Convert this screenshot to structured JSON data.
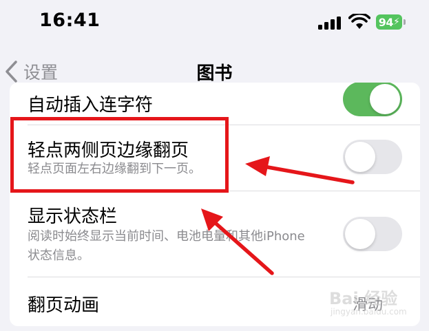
{
  "status_bar": {
    "time": "16:41",
    "battery_level": "94",
    "icons": [
      "cellular-signal-icon",
      "wifi-icon",
      "battery-charging-icon"
    ]
  },
  "nav_bar": {
    "back_label": "设置",
    "title": "图书"
  },
  "settings": {
    "auto_hyphenation": {
      "title": "自动插入连字符",
      "enabled": true
    },
    "tap_edges": {
      "title": "轻点两侧页边缘翻页",
      "subtitle": "轻点页面左右边缘翻到下一页。",
      "enabled": false
    },
    "status_bar_row": {
      "title": "显示状态栏",
      "subtitle": "阅读时始终显示当前时间、电池电量和其他iPhone状态信息。",
      "enabled": false
    },
    "page_animation": {
      "title": "翻页动画",
      "value": "滑动"
    }
  },
  "watermark": {
    "main": "Bai 经验",
    "sub": "jingyan.baidu.com"
  },
  "colors": {
    "accent_green": "#5cb85c",
    "annotation_red": "#e5161a",
    "background": "#f2f2f7",
    "secondary_text": "#8a8a8e"
  }
}
